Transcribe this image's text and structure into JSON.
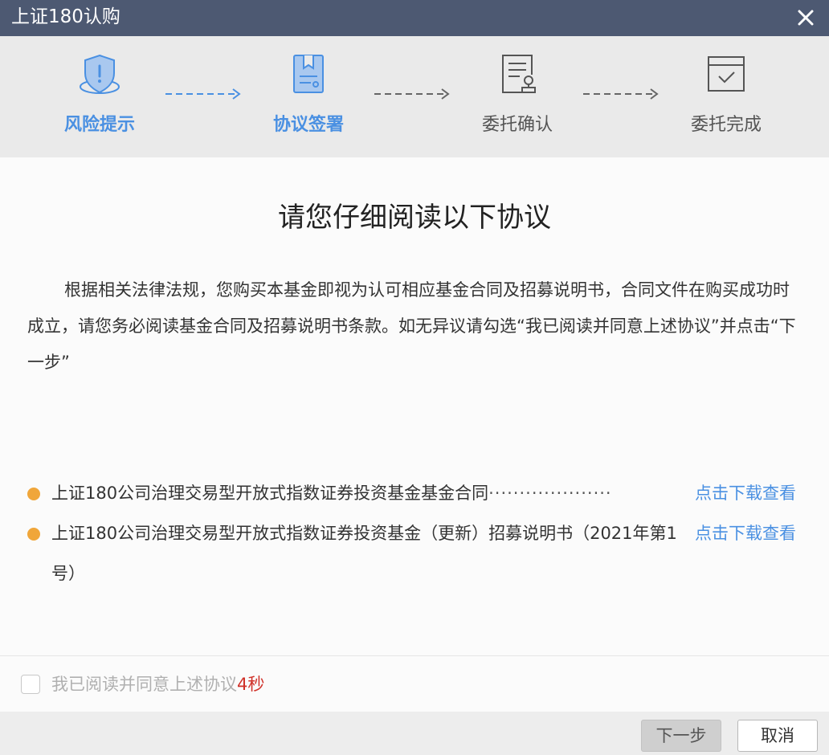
{
  "window": {
    "title": "上证180认购",
    "close_icon": "close-icon"
  },
  "steps": [
    {
      "label": "风险提示",
      "icon": "shield-warning-icon",
      "state": "active"
    },
    {
      "label": "协议签署",
      "icon": "certificate-document-icon",
      "state": "active"
    },
    {
      "label": "委托确认",
      "icon": "document-stamp-icon",
      "state": "inactive"
    },
    {
      "label": "委托完成",
      "icon": "calendar-check-icon",
      "state": "inactive"
    }
  ],
  "colors": {
    "titlebar": "#4d5972",
    "active_step": "#4a90e2",
    "link": "#4a90e2",
    "bullet": "#f0a63a",
    "countdown": "#d0322a"
  },
  "main": {
    "heading": "请您仔细阅读以下协议",
    "paragraph": "根据相关法律法规，您购买本基金即视为认可相应基金合同及招募说明书，合同文件在购买成功时成立，请您务必阅读基金合同及招募说明书条款。如无异议请勾选“我已阅读并同意上述协议”并点击“下一步”",
    "documents": [
      {
        "name": "上证180公司治理交易型开放式指数证券投资基金基金合同",
        "leader": "····················",
        "link": "点击下载查看"
      },
      {
        "name": "上证180公司治理交易型开放式指数证券投资基金（更新）招募说明书（2021年第1号）",
        "leader": "",
        "link": "点击下载查看"
      }
    ]
  },
  "agreement": {
    "label": "我已阅读并同意上述协议",
    "countdown": "4秒",
    "checked": false
  },
  "footer": {
    "next_label": "下一步",
    "cancel_label": "取消"
  }
}
